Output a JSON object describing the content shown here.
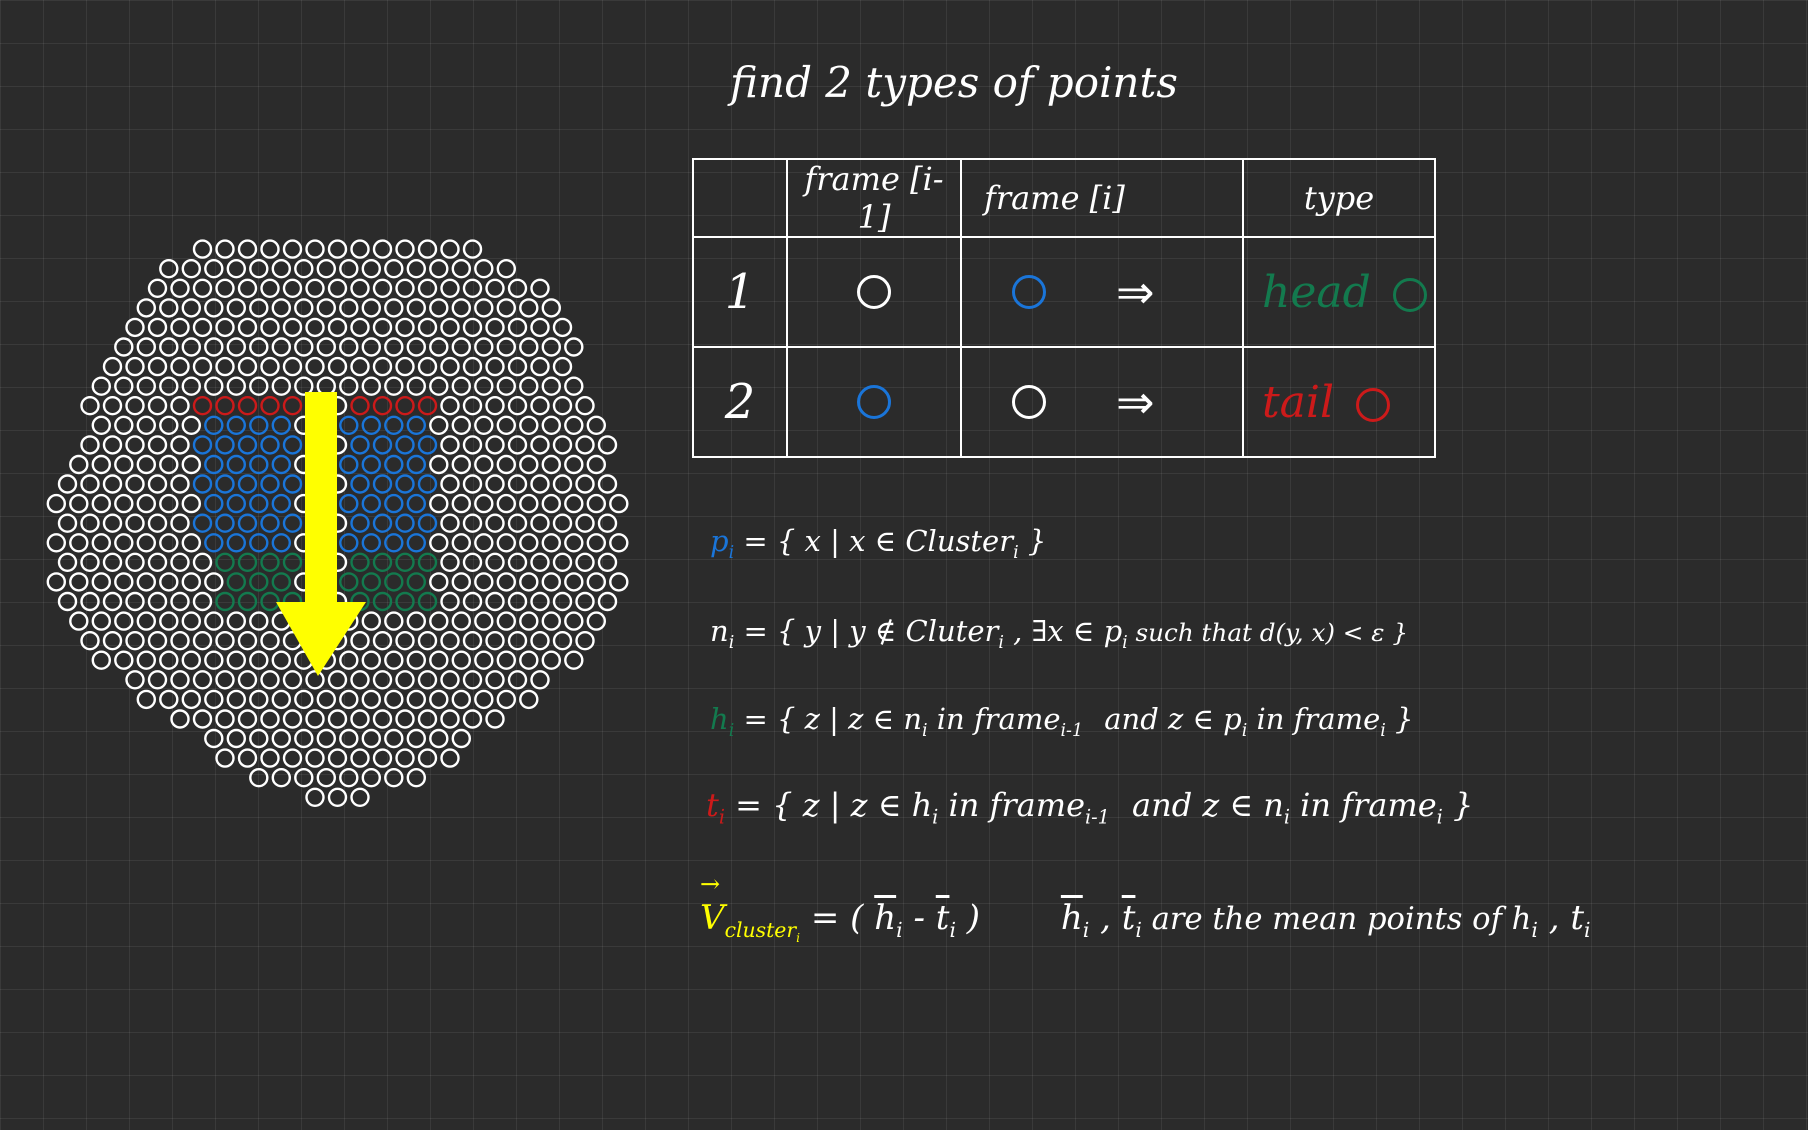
{
  "title": "find 2 types of points",
  "colors": {
    "background": "#2b2b2b",
    "outline": "#ffffff",
    "cluster": "#1a75d9",
    "head": "#137a4e",
    "tail": "#cc1a1a",
    "arrow": "#ffff00"
  },
  "table": {
    "headers": [
      "",
      "frame [i-1]",
      "frame [i]",
      "type"
    ],
    "rows": [
      {
        "num": "1",
        "prev": "white-circle",
        "curr": "blue-circle",
        "arrow": "⇒",
        "type": "head",
        "type_color": "#137a4e"
      },
      {
        "num": "2",
        "prev": "blue-circle",
        "curr": "white-circle",
        "arrow": "⇒",
        "type": "tail",
        "type_color": "#cc1a1a"
      }
    ]
  },
  "formulas": {
    "p": {
      "sym": "p",
      "sub": "i",
      "rhs": " = { x | x ∈ Cluster",
      "rhs_sub": "i",
      "end": " }"
    },
    "n": {
      "sym": "n",
      "sub": "i",
      "rhs": " = { y | y ∉ Cluter",
      "rhs_sub": "i",
      "mid": " , ∃x ∈ p",
      "mid_sub": "i",
      "end": "  such that  d(y, x) < ε }"
    },
    "h": {
      "sym": "h",
      "sub": "i",
      "a": " = { z | z ∈ n",
      "a_sub": "i",
      "b": " in frame",
      "b_sub": "i-1",
      "c": " and  z ∈ p",
      "c_sub": "i",
      "d": " in frame",
      "d_sub": "i",
      "end": " }"
    },
    "t": {
      "sym": "t",
      "sub": "i",
      "a": " = { z | z ∈ h",
      "a_sub": "i",
      "b": " in frame",
      "b_sub": "i-1",
      "c": " and  z ∈ n",
      "c_sub": "i",
      "d": " in frame",
      "d_sub": "i",
      "end": " }"
    },
    "v": {
      "sym": "V",
      "arrow": "→",
      "sub": "cluster",
      "subsub": "i",
      "eq": " = ( ",
      "h": "h",
      "h_sub": "i",
      "minus": " - ",
      "t": "t",
      "t_sub": "i",
      "close": " )",
      "note_h": "h",
      "note_h_sub": "i",
      "comma": " , ",
      "note_t": "t",
      "note_t_sub": "i",
      "note_text": " are the  mean  points  of  h",
      "note_hi": "i",
      "note_comma": " , t",
      "note_ti": "i"
    }
  }
}
